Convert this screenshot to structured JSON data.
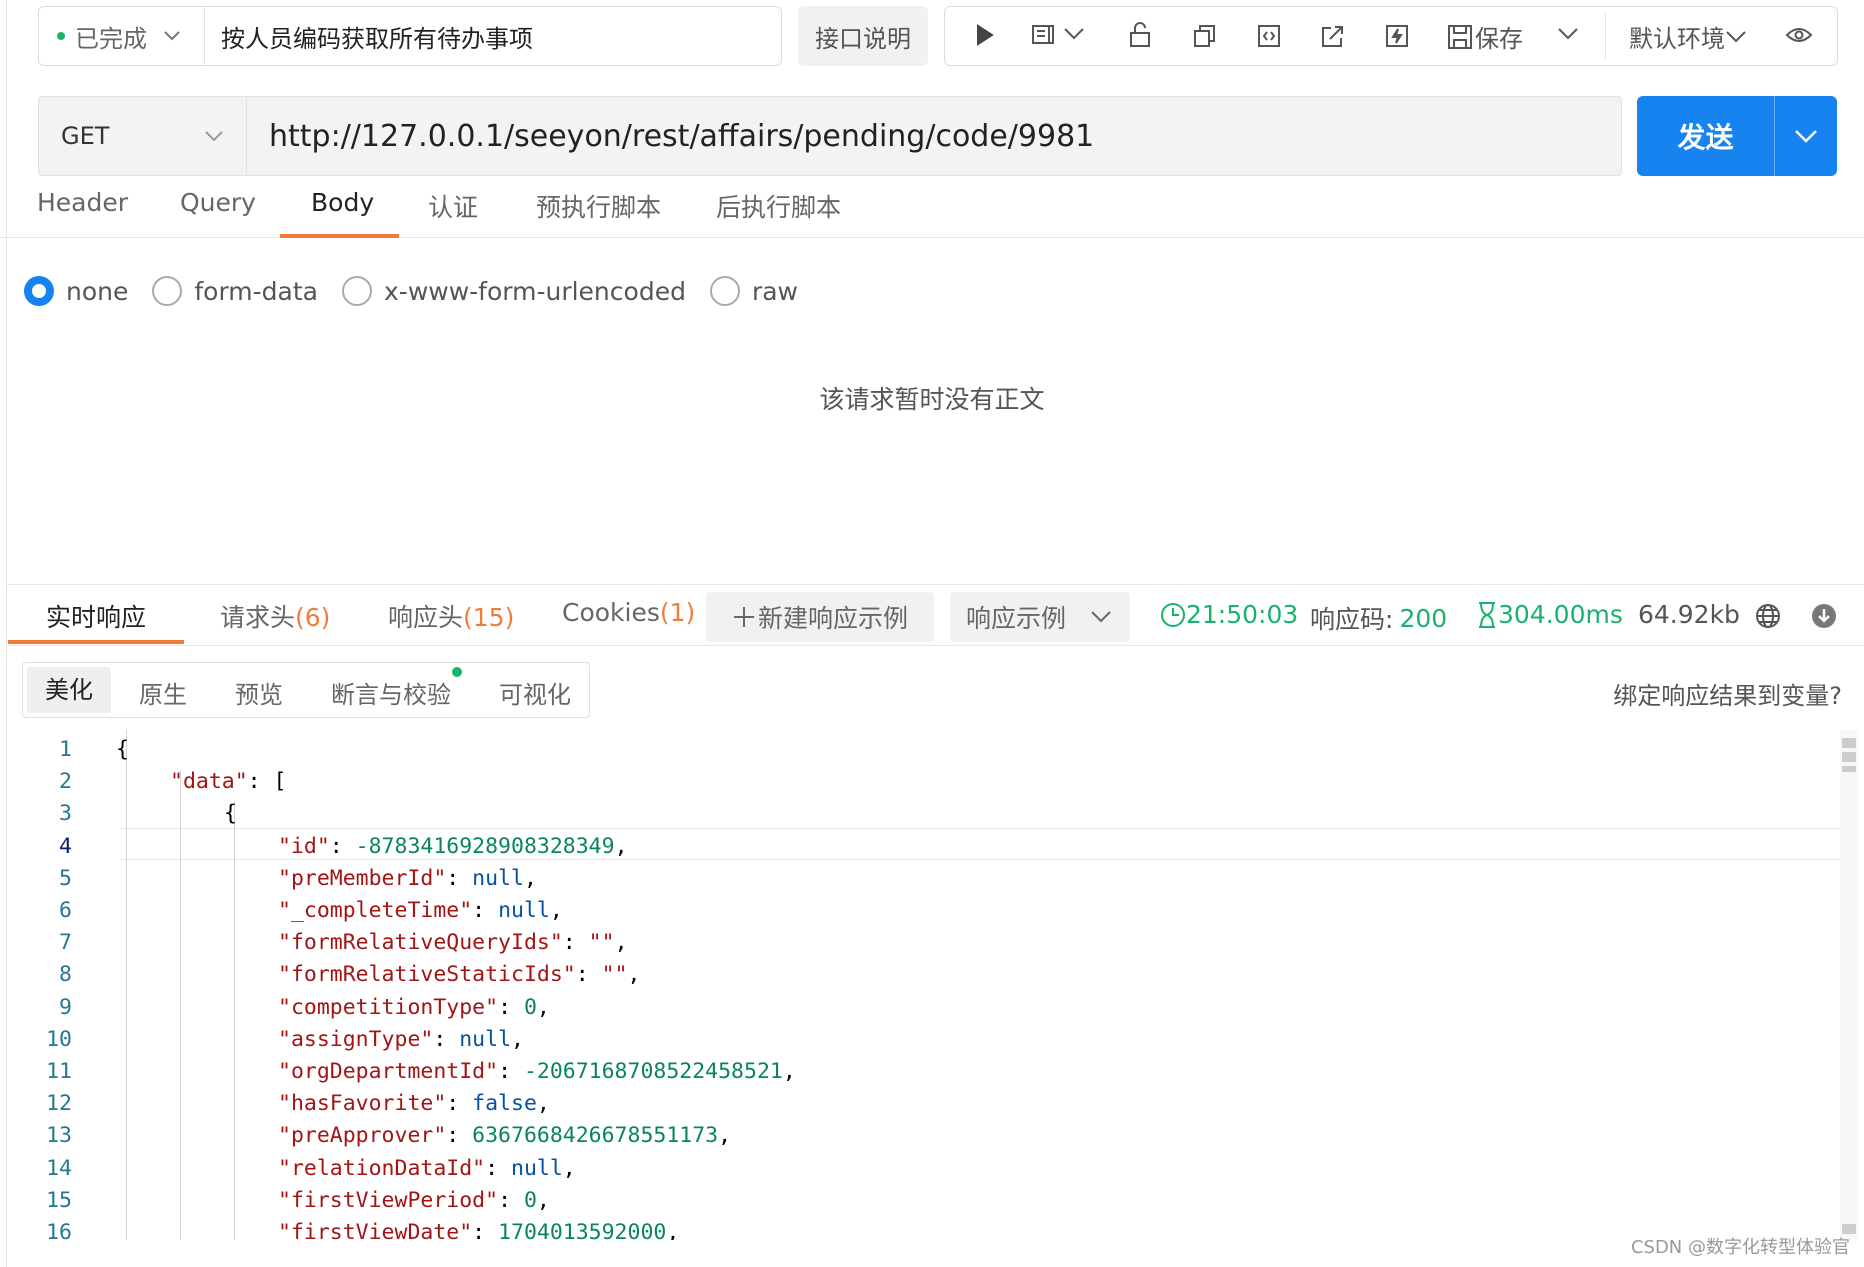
{
  "topbar": {
    "status": "已完成",
    "status_color": "#19b36b",
    "api_name": "按人员编码获取所有待办事项",
    "doc_button": "接口说明",
    "save_label": "保存",
    "env_label": "默认环境",
    "icons": [
      "play-icon",
      "quick-view-icon",
      "chevron-down-icon",
      "lock-icon",
      "copy-icon",
      "code-icon",
      "share-icon",
      "flash-icon",
      "save-icon",
      "chevron-down-icon",
      "chevron-down-icon",
      "eye-icon"
    ]
  },
  "request": {
    "method": "GET",
    "url": "http://127.0.0.1/seeyon/rest/affairs/pending/code/9981",
    "send_label": "发送",
    "send_color": "#1683f0",
    "tabs": [
      "Header",
      "Query",
      "Body",
      "认证",
      "预执行脚本",
      "后执行脚本"
    ],
    "active_tab": "Body"
  },
  "body": {
    "types": [
      "none",
      "form-data",
      "x-www-form-urlencoded",
      "raw"
    ],
    "selected": "none",
    "empty_message": "该请求暂时没有正文"
  },
  "response": {
    "tabs": {
      "realtime": "实时响应",
      "req_headers": "请求头",
      "req_headers_count": "(6)",
      "resp_headers": "响应头",
      "resp_headers_count": "(15)",
      "cookies": "Cookies",
      "cookies_count": "(1)"
    },
    "new_example": "新建响应示例",
    "example_select": "响应示例",
    "time": "21:50:03",
    "code_label": "响应码:",
    "code": "200",
    "duration": "304.00ms",
    "size": "64.92kb",
    "view_tabs": [
      "美化",
      "原生",
      "预览",
      "断言与校验",
      "可视化"
    ],
    "bind_link": "绑定响应结果到变量?",
    "accent_color": "#f07c3c"
  },
  "code": {
    "lines": [
      {
        "n": "1",
        "indent": 0,
        "parts": [
          [
            "p",
            "{"
          ]
        ]
      },
      {
        "n": "2",
        "indent": 1,
        "parts": [
          [
            "k",
            "\"data\""
          ],
          [
            "p",
            ": ["
          ]
        ]
      },
      {
        "n": "3",
        "indent": 2,
        "parts": [
          [
            "p",
            "{"
          ]
        ]
      },
      {
        "n": "4",
        "indent": 3,
        "parts": [
          [
            "k",
            "\"id\""
          ],
          [
            "p",
            ": "
          ],
          [
            "n",
            "-8783416928908328349"
          ],
          [
            "p",
            ","
          ]
        ]
      },
      {
        "n": "5",
        "indent": 3,
        "parts": [
          [
            "k",
            "\"preMemberId\""
          ],
          [
            "p",
            ": "
          ],
          [
            "kw",
            "null"
          ],
          [
            "p",
            ","
          ]
        ]
      },
      {
        "n": "6",
        "indent": 3,
        "parts": [
          [
            "k",
            "\"_completeTime\""
          ],
          [
            "p",
            ": "
          ],
          [
            "kw",
            "null"
          ],
          [
            "p",
            ","
          ]
        ]
      },
      {
        "n": "7",
        "indent": 3,
        "parts": [
          [
            "k",
            "\"formRelativeQueryIds\""
          ],
          [
            "p",
            ": "
          ],
          [
            "k",
            "\"\""
          ],
          [
            "p",
            ","
          ]
        ]
      },
      {
        "n": "8",
        "indent": 3,
        "parts": [
          [
            "k",
            "\"formRelativeStaticIds\""
          ],
          [
            "p",
            ": "
          ],
          [
            "k",
            "\"\""
          ],
          [
            "p",
            ","
          ]
        ]
      },
      {
        "n": "9",
        "indent": 3,
        "parts": [
          [
            "k",
            "\"competitionType\""
          ],
          [
            "p",
            ": "
          ],
          [
            "n",
            "0"
          ],
          [
            "p",
            ","
          ]
        ]
      },
      {
        "n": "10",
        "indent": 3,
        "parts": [
          [
            "k",
            "\"assignType\""
          ],
          [
            "p",
            ": "
          ],
          [
            "kw",
            "null"
          ],
          [
            "p",
            ","
          ]
        ]
      },
      {
        "n": "11",
        "indent": 3,
        "parts": [
          [
            "k",
            "\"orgDepartmentId\""
          ],
          [
            "p",
            ": "
          ],
          [
            "n",
            "-2067168708522458521"
          ],
          [
            "p",
            ","
          ]
        ]
      },
      {
        "n": "12",
        "indent": 3,
        "parts": [
          [
            "k",
            "\"hasFavorite\""
          ],
          [
            "p",
            ": "
          ],
          [
            "kw",
            "false"
          ],
          [
            "p",
            ","
          ]
        ]
      },
      {
        "n": "13",
        "indent": 3,
        "parts": [
          [
            "k",
            "\"preApprover\""
          ],
          [
            "p",
            ": "
          ],
          [
            "n",
            "6367668426678551173"
          ],
          [
            "p",
            ","
          ]
        ]
      },
      {
        "n": "14",
        "indent": 3,
        "parts": [
          [
            "k",
            "\"relationDataId\""
          ],
          [
            "p",
            ": "
          ],
          [
            "kw",
            "null"
          ],
          [
            "p",
            ","
          ]
        ]
      },
      {
        "n": "15",
        "indent": 3,
        "parts": [
          [
            "k",
            "\"firstViewPeriod\""
          ],
          [
            "p",
            ": "
          ],
          [
            "n",
            "0"
          ],
          [
            "p",
            ","
          ]
        ]
      },
      {
        "n": "16",
        "indent": 3,
        "parts": [
          [
            "k",
            "\"firstViewDate\""
          ],
          [
            "p",
            ": "
          ],
          [
            "n",
            "1704013592000"
          ],
          [
            "p",
            ","
          ]
        ]
      }
    ],
    "current_line": "4"
  },
  "watermark": "CSDN @数字化转型体验官"
}
